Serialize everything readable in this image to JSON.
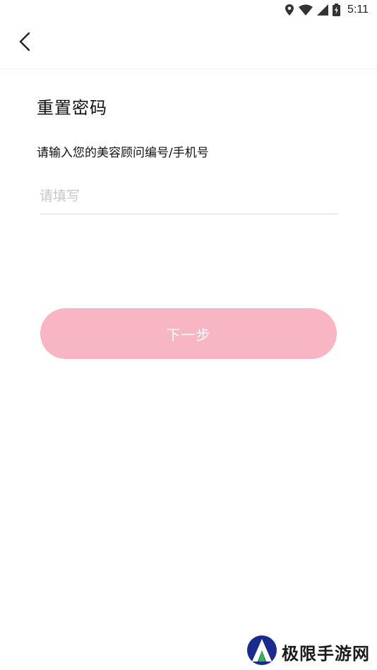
{
  "status_bar": {
    "time": "5:11",
    "icons": [
      "location-icon",
      "wifi-icon",
      "signal-icon",
      "battery-charging-icon"
    ]
  },
  "nav": {
    "back_icon": "chevron-left-icon"
  },
  "page": {
    "title": "重置密码",
    "prompt": "请输入您的美容顾问编号/手机号",
    "input_value": "",
    "input_placeholder": "请填写",
    "next_button_label": "下一步"
  },
  "colors": {
    "button_bg": "#f8b5c3",
    "button_text": "#ffffff",
    "placeholder": "#c6c6c6",
    "divider": "#d8d8d8"
  },
  "watermark": {
    "text": "极限手游网",
    "logo_icon": "watermark-logo-icon"
  }
}
